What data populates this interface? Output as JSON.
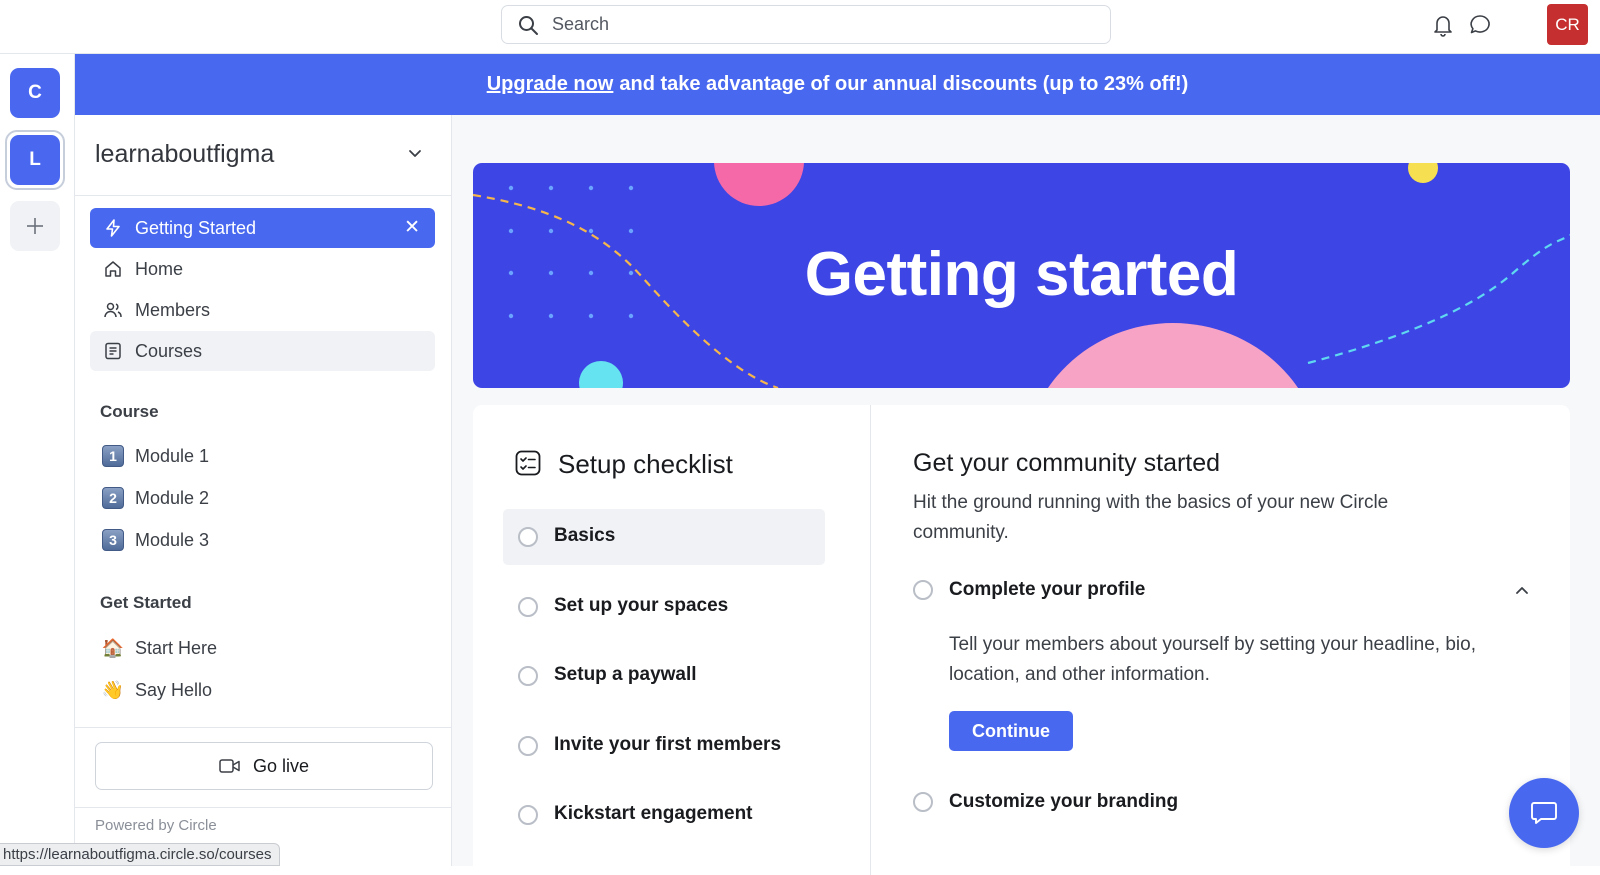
{
  "header": {
    "search_placeholder": "Search",
    "avatar_initials": "CR"
  },
  "rail": {
    "communities": [
      {
        "initial": "C"
      },
      {
        "initial": "L"
      }
    ]
  },
  "banner": {
    "link_text": "Upgrade now",
    "text": "and take advantage of our annual discounts (up to 23% off!)"
  },
  "sidebar": {
    "community_name": "learnaboutfigma",
    "nav": [
      {
        "label": "Getting Started",
        "icon": "lightning-icon",
        "state": "active"
      },
      {
        "label": "Home",
        "icon": "home-icon"
      },
      {
        "label": "Members",
        "icon": "members-icon"
      },
      {
        "label": "Courses",
        "icon": "courses-icon",
        "state": "hover"
      }
    ],
    "sections": [
      {
        "title": "Course",
        "items": [
          {
            "label": "Module 1",
            "badge": "1"
          },
          {
            "label": "Module 2",
            "badge": "2"
          },
          {
            "label": "Module 3",
            "badge": "3"
          }
        ]
      },
      {
        "title": "Get Started",
        "items": [
          {
            "label": "Start Here",
            "emoji": "🏠"
          },
          {
            "label": "Say Hello",
            "emoji": "👋"
          }
        ]
      }
    ],
    "go_live_label": "Go live",
    "powered_by": "Powered by Circle"
  },
  "status_url": "https://learnaboutfigma.circle.so/courses",
  "hero": {
    "title": "Getting started"
  },
  "checklist": {
    "title": "Setup checklist",
    "items": [
      {
        "label": "Basics",
        "selected": true
      },
      {
        "label": "Set up your spaces"
      },
      {
        "label": "Setup a paywall"
      },
      {
        "label": "Invite your first members"
      },
      {
        "label": "Kickstart engagement"
      }
    ]
  },
  "detail": {
    "title": "Get your community started",
    "description": "Hit the ground running with the basics of your new Circle community.",
    "tasks": [
      {
        "label": "Complete your profile",
        "expanded": true,
        "description": "Tell your members about yourself by setting your headline, bio, location, and other information.",
        "button": "Continue"
      },
      {
        "label": "Customize your branding"
      }
    ]
  },
  "colors": {
    "accent": "#4868ef",
    "hero_bg": "#3d45e5",
    "avatar_bg": "#c62f2f"
  }
}
